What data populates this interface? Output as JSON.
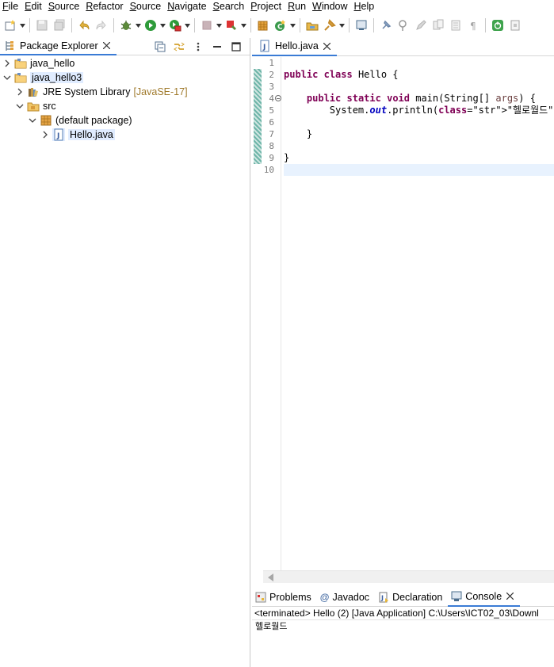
{
  "menubar": [
    "File",
    "Edit",
    "Source",
    "Refactor",
    "Source",
    "Navigate",
    "Search",
    "Project",
    "Run",
    "Window",
    "Help"
  ],
  "toolbar_icons": [
    "new-icon",
    "save-icon",
    "save-all-icon",
    "undo-icon",
    "redo-icon",
    "debug-icon",
    "run-icon",
    "coverage-icon",
    "stop-icon",
    "external-tools-icon",
    "open-type-icon",
    "new-java-class-icon",
    "open-task-icon",
    "search-icon",
    "console-icon",
    "pin-icon",
    "toggle-mark-icon",
    "show-whitespace-icon",
    "spring-boot-icon",
    "block-icon",
    "shortcut-icon"
  ],
  "package_explorer": {
    "title": "Package Explorer",
    "tree": [
      {
        "label": "java_hello",
        "icon": "project-icon",
        "expanded": false
      },
      {
        "label": "java_hello3",
        "icon": "project-icon",
        "expanded": true,
        "selected": true
      },
      {
        "label": "JRE System Library",
        "decoration": "[JavaSE-17]",
        "icon": "library-icon",
        "expanded": false
      },
      {
        "label": "src",
        "icon": "source-folder-icon",
        "expanded": true
      },
      {
        "label": "(default package)",
        "icon": "package-icon",
        "expanded": true
      },
      {
        "label": "Hello.java",
        "icon": "java-file-icon",
        "expanded": false,
        "highlighted": true
      }
    ]
  },
  "editor": {
    "tab_label": "Hello.java",
    "line_numbers": [
      "1",
      "2",
      "3",
      "4",
      "5",
      "6",
      "7",
      "8",
      "9",
      "10"
    ],
    "lines": [
      "",
      "public class Hello {",
      "",
      "    public static void main(String[] args) {",
      "        System.out.println(\"헬로월드\");",
      "",
      "    }",
      "",
      "}",
      ""
    ],
    "folding_marker_line": "4"
  },
  "console": {
    "tabs": [
      {
        "label": "Problems",
        "icon": "problems-icon"
      },
      {
        "label": "Javadoc",
        "icon": "javadoc-icon"
      },
      {
        "label": "Declaration",
        "icon": "declaration-icon"
      },
      {
        "label": "Console",
        "icon": "console-icon",
        "active": true
      }
    ],
    "status": "<terminated> Hello (2) [Java Application] C:\\Users\\ICT02_03\\Downl",
    "output": "헬로월드"
  },
  "colors": {
    "keyword": "#7f0055",
    "string": "#2a00ff",
    "field": "#0000c0",
    "selection": "#e0ecff",
    "active_tab_border": "#3a7bd5"
  }
}
